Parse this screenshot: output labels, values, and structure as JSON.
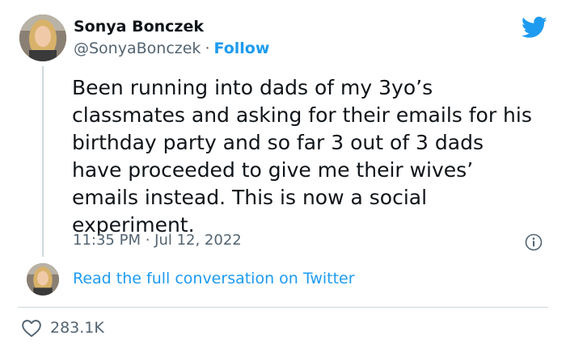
{
  "author": {
    "name": "Sonya Bonczek",
    "handle": "@SonyaBonczek",
    "separator": "·",
    "follow_label": "Follow"
  },
  "tweet": {
    "lines": [
      "Been running into dads of my 3yo’s",
      "classmates and asking for their emails for his",
      "birthday party and so far 3 out of 3 dads",
      "have proceeded to give me their wives’",
      "emails instead. This is now a social",
      "experiment."
    ],
    "timestamp": "11:35 PM · Jul 12, 2022"
  },
  "footer": {
    "read_more": "Read the full conversation on Twitter",
    "like_count": "283.1K"
  },
  "colors": {
    "accent": "#1d9bf0",
    "text": "#0f1419",
    "muted": "#536471",
    "border": "#cfd9de"
  },
  "icons": {
    "brand": "twitter-bird-icon",
    "info": "info-icon",
    "like": "heart-icon"
  }
}
